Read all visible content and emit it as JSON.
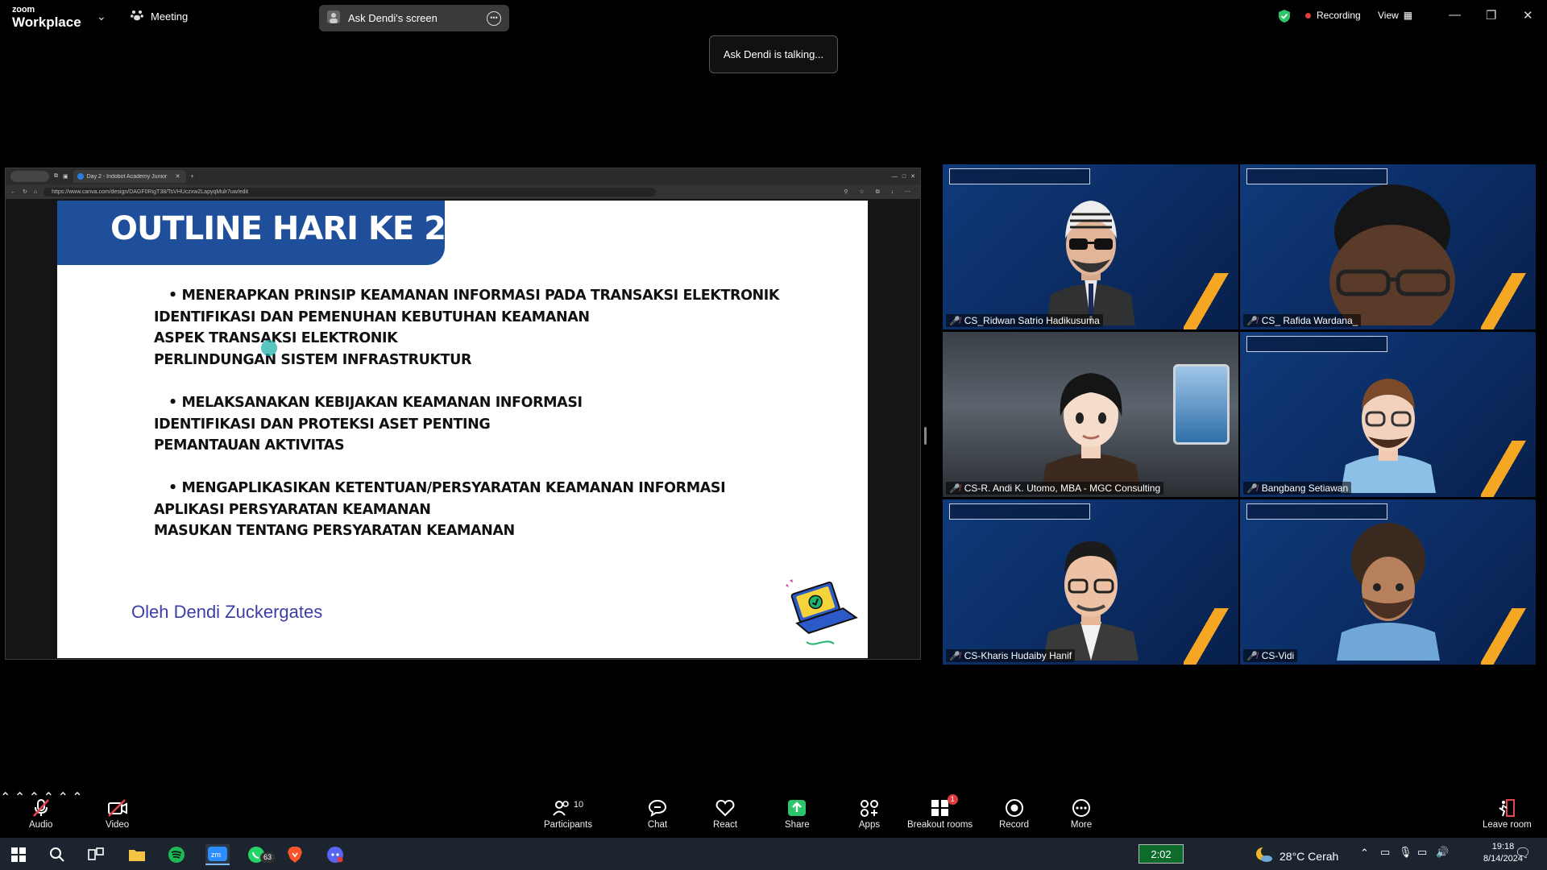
{
  "app": {
    "brand_line1": "zoom",
    "brand_line2": "Workplace",
    "meeting_label": "Meeting",
    "share_label": "Ask Dendi's screen",
    "recording_label": "Recording",
    "view_label": "View",
    "talking_toast": "Ask Dendi is talking..."
  },
  "browser": {
    "tab_title": "Day 2 - Indobot Academy Junior",
    "url": "https://www.canva.com/design/DAGF0RigT38/TsVHUczxw2LapyqMulr7uw/edit"
  },
  "slide": {
    "title": "OUTLINE HARI KE 2",
    "sections": [
      {
        "bullet": "MENERAPKAN PRINSIP KEAMANAN INFORMASI PADA TRANSAKSI ELEKTRONIK",
        "lines": [
          "IDENTIFIKASI DAN PEMENUHAN KEBUTUHAN KEAMANAN",
          "ASPEK TRANSAKSI ELEKTRONIK",
          "PERLINDUNGAN SISTEM INFRASTRUKTUR"
        ]
      },
      {
        "bullet": "MELAKSANAKAN KEBIJAKAN KEAMANAN INFORMASI",
        "lines": [
          "IDENTIFIKASI DAN PROTEKSI ASET PENTING",
          "PEMANTAUAN AKTIVITAS"
        ]
      },
      {
        "bullet": "MENGAPLIKASIKAN KETENTUAN/PERSYARATAN KEAMANAN INFORMASI",
        "lines": [
          "APLIKASI PERSYARATAN KEAMANAN",
          "MASUKAN TENTANG PERSYARATAN KEAMANAN"
        ]
      }
    ],
    "author": "Oleh Dendi Zuckergates"
  },
  "participants": [
    {
      "name": "CS_Ridwan Satrio Hadikusuma",
      "avatar": "sunglasses-avatar"
    },
    {
      "name": "CS_ Rafida Wardana_",
      "avatar": "camera-face"
    },
    {
      "name": "CS-R. Andi K. Utomo, MBA - MGC Consulting",
      "avatar": "anime-avatar"
    },
    {
      "name": "Bangbang Setiawan",
      "avatar": "bearded-avatar"
    },
    {
      "name": "CS-Kharis Hudaiby Hanif",
      "avatar": "glasses-avatar"
    },
    {
      "name": "CS-Vidi",
      "avatar": "curly-beard-avatar"
    }
  ],
  "toolbar": {
    "audio": "Audio",
    "video": "Video",
    "participants": "Participants",
    "participants_count": "10",
    "chat": "Chat",
    "react": "React",
    "share": "Share",
    "apps": "Apps",
    "breakout": "Breakout rooms",
    "breakout_badge": "1",
    "record": "Record",
    "more": "More",
    "leave": "Leave room"
  },
  "taskbar": {
    "whatsapp_badge": "63",
    "timer": "2:02",
    "weather": "28°C  Cerah",
    "time": "19:18",
    "date": "8/14/2024"
  },
  "colors": {
    "slide_banner": "#1f4e9b",
    "author_text": "#3b3ea7",
    "share_green": "#2cc56b",
    "recording_red": "#e23b3b"
  }
}
